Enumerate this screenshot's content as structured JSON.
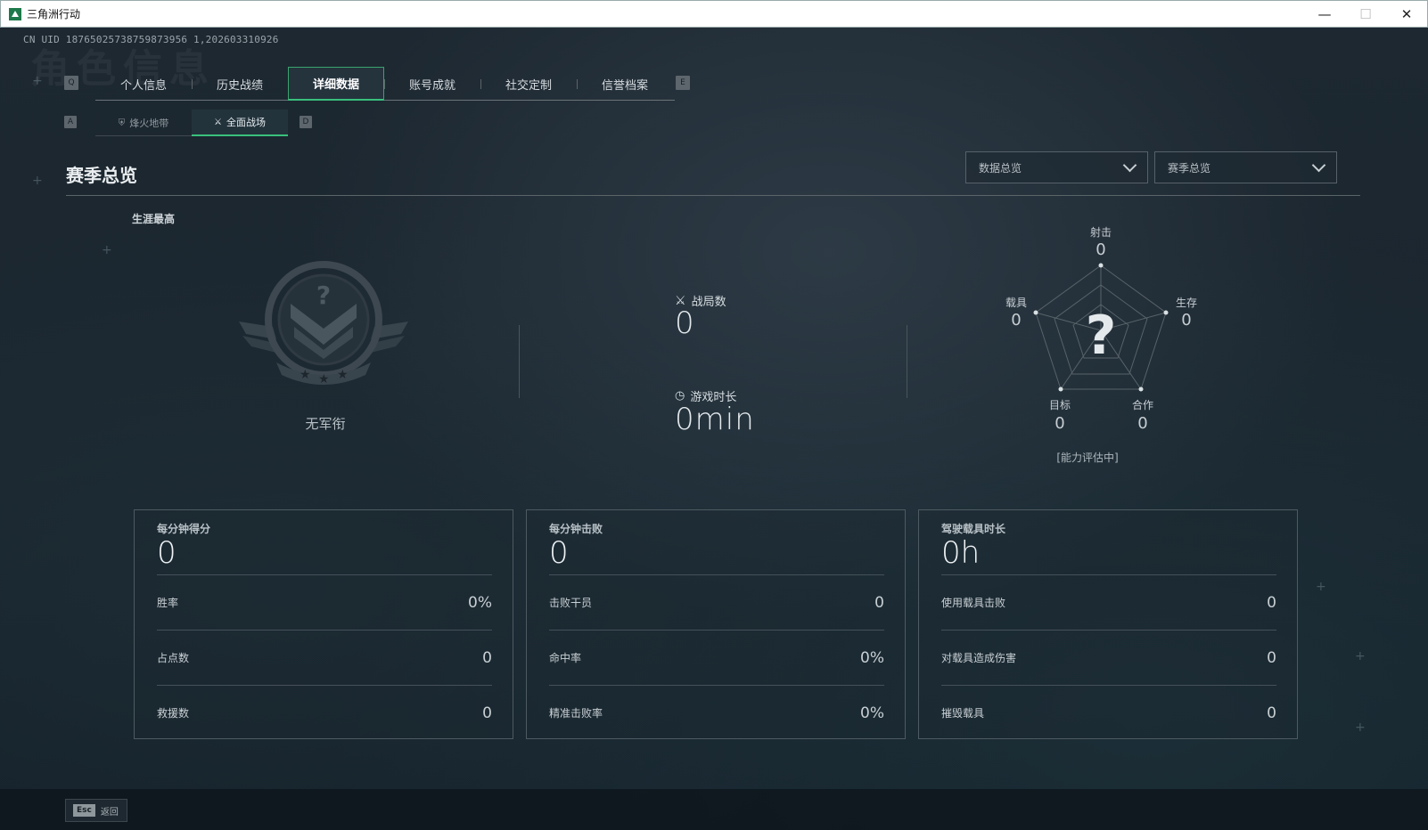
{
  "window": {
    "title": "三角洲行动",
    "minimize": "—",
    "maximize": "☐",
    "close": "✕"
  },
  "uid": "CN UID 18765025738759873956 1,202603310926",
  "watermark": "角色信息",
  "keys": {
    "tab_left": "Q",
    "tab_right": "E",
    "sub_left": "A",
    "sub_right": "D"
  },
  "tabs": [
    {
      "label": "个人信息",
      "active": false
    },
    {
      "label": "历史战绩",
      "active": false
    },
    {
      "label": "详细数据",
      "active": true
    },
    {
      "label": "账号成就",
      "active": false
    },
    {
      "label": "社交定制",
      "active": false
    },
    {
      "label": "信誉档案",
      "active": false
    }
  ],
  "subtabs": [
    {
      "label": "烽火地带",
      "icon": "⛨",
      "active": false
    },
    {
      "label": "全面战场",
      "icon": "⚔",
      "active": true
    }
  ],
  "section": {
    "title": "赛季总览"
  },
  "filters": {
    "data_select": "数据总览",
    "season_select": "赛季总览"
  },
  "career": {
    "label": "生涯最高",
    "rank_name": "无军衔"
  },
  "summary": {
    "matches_label": "战局数",
    "matches_value": "0",
    "playtime_label": "游戏时长",
    "playtime_value": "0min"
  },
  "radar": {
    "status": "[能力评估中]",
    "center_glyph": "?",
    "axes": [
      {
        "label": "射击",
        "value": "0"
      },
      {
        "label": "生存",
        "value": "0"
      },
      {
        "label": "合作",
        "value": "0"
      },
      {
        "label": "目标",
        "value": "0"
      },
      {
        "label": "载具",
        "value": "0"
      }
    ]
  },
  "cards": [
    {
      "title": "每分钟得分",
      "value": "0",
      "rows": [
        {
          "label": "胜率",
          "value": "0%"
        },
        {
          "label": "占点数",
          "value": "0"
        },
        {
          "label": "救援数",
          "value": "0"
        }
      ]
    },
    {
      "title": "每分钟击败",
      "value": "0",
      "rows": [
        {
          "label": "击败干员",
          "value": "0"
        },
        {
          "label": "命中率",
          "value": "0%"
        },
        {
          "label": "精准击败率",
          "value": "0%"
        }
      ]
    },
    {
      "title": "驾驶载具时长",
      "value": "0h",
      "rows": [
        {
          "label": "使用载具击败",
          "value": "0"
        },
        {
          "label": "对载具造成伤害",
          "value": "0"
        },
        {
          "label": "摧毁载具",
          "value": "0"
        }
      ]
    }
  ],
  "footer": {
    "esc_key": "Esc",
    "back_label": "返回"
  },
  "colors": {
    "accent": "#39c07c",
    "background": "#1b262f"
  }
}
